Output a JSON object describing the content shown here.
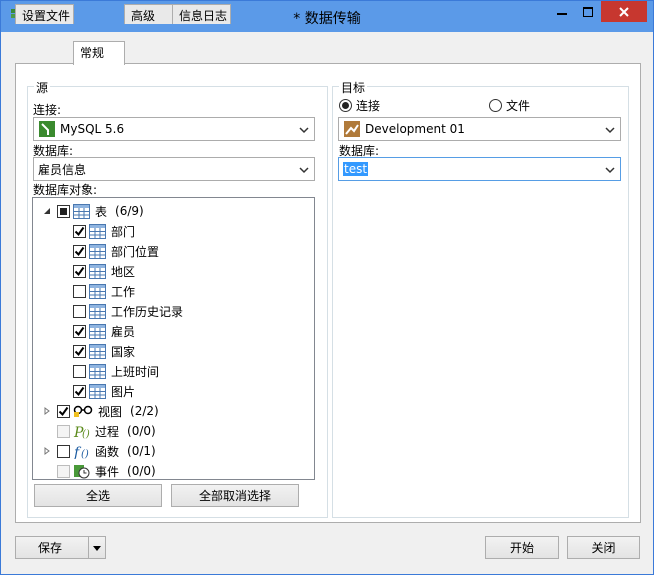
{
  "window": {
    "title": "* 数据传输"
  },
  "tabs": [
    "设置文件",
    "常规",
    "高级",
    "信息日志"
  ],
  "source": {
    "group_label": "源",
    "connection_label": "连接:",
    "connection_value": "MySQL 5.6",
    "database_label": "数据库:",
    "database_value": "雇员信息",
    "objects_label": "数据库对象:",
    "tree": [
      {
        "label": "表",
        "count": "(6/9)",
        "children": [
          {
            "label": "部门",
            "checked": true
          },
          {
            "label": "部门位置",
            "checked": true
          },
          {
            "label": "地区",
            "checked": true
          },
          {
            "label": "工作",
            "checked": false
          },
          {
            "label": "工作历史记录",
            "checked": false
          },
          {
            "label": "雇员",
            "checked": true
          },
          {
            "label": "国家",
            "checked": true
          },
          {
            "label": "上班时间",
            "checked": false
          },
          {
            "label": "图片",
            "checked": true
          }
        ]
      },
      {
        "label": "视图",
        "count": "(2/2)"
      },
      {
        "label": "过程",
        "count": "(0/0)"
      },
      {
        "label": "函数",
        "count": "(0/1)"
      },
      {
        "label": "事件",
        "count": "(0/0)"
      }
    ],
    "select_all_button": "全选",
    "deselect_all_button": "全部取消选择"
  },
  "target": {
    "group_label": "目标",
    "radio_connection": "连接",
    "radio_file": "文件",
    "connection_value": "Development 01",
    "database_label": "数据库:",
    "database_value": "test"
  },
  "footer": {
    "save_button": "保存",
    "start_button": "开始",
    "close_button": "关闭"
  }
}
